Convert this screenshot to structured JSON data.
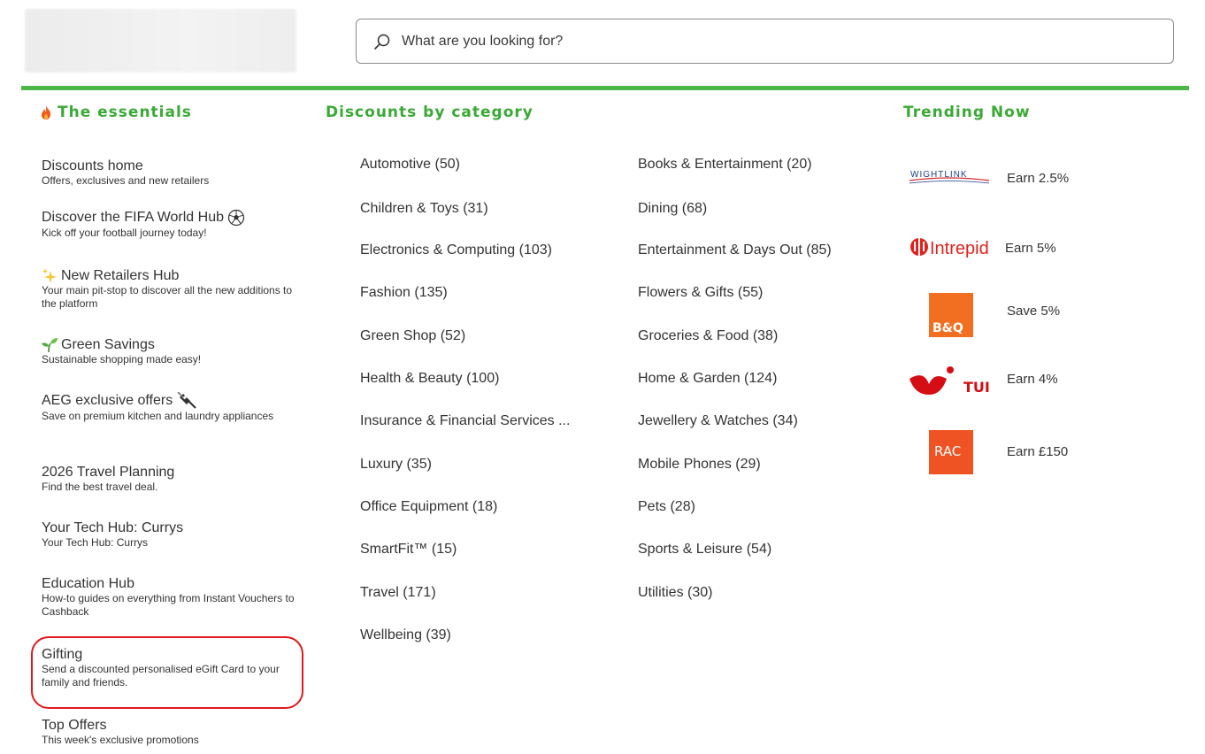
{
  "search": {
    "placeholder": "What are you looking for?"
  },
  "headers": {
    "essentials": "The essentials",
    "discounts": "Discounts by category",
    "trending": "Trending Now"
  },
  "essentials": [
    {
      "title": "Discounts home",
      "sub": "Offers, exclusives and new retailers",
      "icon": ""
    },
    {
      "title": "Discover the FIFA World Hub",
      "sub": "Kick off your football journey today!",
      "icon": "football-icon"
    },
    {
      "title": "New Retailers Hub",
      "sub": "Your main pit-stop to discover all the new additions to the platform",
      "icon": "sparkles-icon"
    },
    {
      "title": "Green Savings",
      "sub": "Sustainable shopping made easy!",
      "icon": "seedling-icon"
    },
    {
      "title": "AEG exclusive offers",
      "sub": "Save on premium kitchen and laundry appliances",
      "icon": "plug-icon"
    },
    {
      "title": "2026 Travel Planning",
      "sub": "Find the best travel deal.",
      "icon": ""
    },
    {
      "title": "Your Tech Hub: Currys",
      "sub": "Your Tech Hub: Currys",
      "icon": ""
    },
    {
      "title": "Education Hub",
      "sub": "How-to guides on everything from Instant Vouchers to Cashback",
      "icon": ""
    },
    {
      "title": "Gifting",
      "sub": "Send a discounted personalised eGift Card to your family and friends.",
      "icon": ""
    },
    {
      "title": "Top Offers",
      "sub": "This week's exclusive promotions",
      "icon": ""
    }
  ],
  "categories_left": [
    "Automotive (50)",
    "Children & Toys (31)",
    "Electronics & Computing (103)",
    "Fashion (135)",
    "Green Shop (52)",
    "Health & Beauty (100)",
    "Insurance & Financial Services ...",
    "Luxury (35)",
    "Office Equipment (18)",
    "SmartFit™ (15)",
    "Travel (171)",
    "Wellbeing (39)"
  ],
  "categories_right": [
    "Books & Entertainment (20)",
    "Dining (68)",
    "Entertainment & Days Out (85)",
    "Flowers & Gifts (55)",
    "Groceries & Food (38)",
    "Home & Garden (124)",
    "Jewellery & Watches (34)",
    "Mobile Phones (29)",
    "Pets (28)",
    "Sports & Leisure (54)",
    "Utilities (30)"
  ],
  "trending": [
    {
      "brand": "WIGHTLINK",
      "earn": "Earn 2.5%",
      "logo": "wightlink-logo"
    },
    {
      "brand": "Intrepid",
      "earn": "Earn 5%",
      "logo": "intrepid-logo"
    },
    {
      "brand": "B&Q",
      "earn": "Save 5%",
      "logo": "bandq-logo"
    },
    {
      "brand": "TUI",
      "earn": "Earn 4%",
      "logo": "tui-logo"
    },
    {
      "brand": "RAC",
      "earn": "Earn £150",
      "logo": "rac-logo"
    }
  ],
  "colors": {
    "accent_green": "#4cb648",
    "heading_green": "#3aa935",
    "highlight_red": "#e0181c",
    "bq_orange": "#f26f21",
    "tui_red": "#d40e14"
  }
}
